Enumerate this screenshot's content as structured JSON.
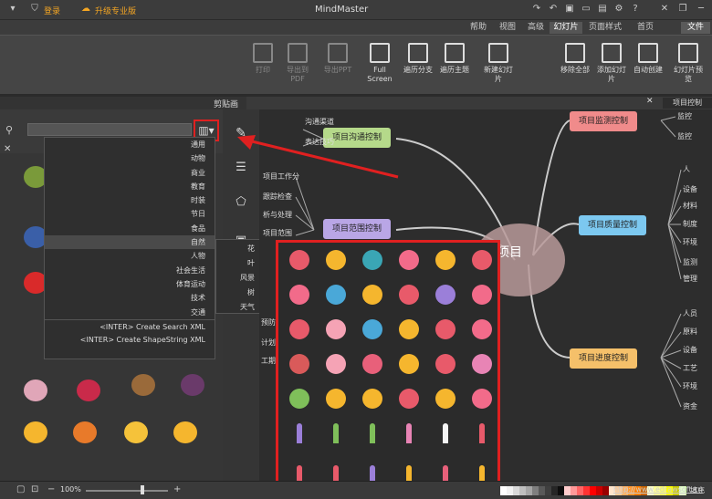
{
  "app": {
    "title": "MindMaster",
    "upgrade": "升级专业版",
    "login": "登录"
  },
  "menu": {
    "file": "文件",
    "tabs": [
      "首页",
      "页面样式",
      "幻灯片",
      "高级",
      "视图",
      "帮助"
    ]
  },
  "ribbon": {
    "buttons": [
      {
        "label": "幻灯片预览",
        "icon": "slides-preview-icon"
      },
      {
        "label": "自动创建",
        "icon": "auto-create-icon"
      },
      {
        "label": "添加幻灯片",
        "icon": "add-slide-icon"
      },
      {
        "label": "移除全部",
        "icon": "remove-all-icon"
      },
      {
        "label": "新建幻灯片",
        "icon": "new-slide-icon"
      },
      {
        "label": "遍历主题",
        "icon": "traverse-topic-icon"
      },
      {
        "label": "遍历分支",
        "icon": "traverse-branch-icon"
      },
      {
        "label": "Full Screen",
        "icon": "fullscreen-icon"
      },
      {
        "label": "导出PPT",
        "icon": "export-ppt-icon"
      },
      {
        "label": "导出到PDF",
        "icon": "export-pdf-icon"
      },
      {
        "label": "打印",
        "icon": "print-icon"
      }
    ]
  },
  "document_tab": {
    "label": "项目控制"
  },
  "clipart_panel": {
    "title": "剪贴画",
    "search_placeholder": "",
    "dropdown_items": [
      "通用",
      "动物",
      "商业",
      "教育",
      "时装",
      "节日",
      "食品",
      "自然",
      "人物",
      "社会生活",
      "体育运动",
      "技术",
      "交通",
      "<INTER> Create Search XML",
      "<INTER> Create ShapeString XML"
    ],
    "highlighted_item": "自然",
    "submenu_items": [
      "花",
      "叶",
      "风景",
      "树",
      "天气"
    ]
  },
  "mindmap": {
    "central": "项目",
    "right_topics": [
      {
        "label": "项目沟通控制",
        "color": "#b5d98a",
        "subs": [
          "沟通渠道",
          "表达技巧"
        ]
      },
      {
        "label": "项目范围控制",
        "color": "#b9a6e6",
        "subs": [
          "项目工作分",
          "跟踪检查",
          "析与处理",
          "项目范围"
        ]
      }
    ],
    "left_topics": [
      {
        "label": "项目监测控制",
        "color": "#f08b8b",
        "subs": [
          "监控",
          "监控"
        ]
      },
      {
        "label": "项目质量控制",
        "color": "#7cc8f0",
        "subs": [
          "人",
          "设备",
          "材料",
          "制度",
          "环境",
          "监测",
          "管理"
        ]
      },
      {
        "label": "项目进度控制",
        "color": "#f5c06a",
        "subs": [
          "人员",
          "原料",
          "设备",
          "工艺",
          "环境",
          "资金"
        ]
      }
    ],
    "mid_labels": [
      "预防",
      "计划",
      "工期"
    ]
  },
  "status": {
    "zoom": "100%",
    "url": "http://www.edrawsoft.cn",
    "fill_label": "填充"
  },
  "palette": [
    "#ffffff",
    "#f2f2f2",
    "#d9d9d9",
    "#bfbfbf",
    "#a6a6a6",
    "#7f7f7f",
    "#595959",
    "#3f3f3f",
    "#262626",
    "#0d0d0d",
    "#ffcccc",
    "#ff9999",
    "#ff6666",
    "#ff3333",
    "#ff0000",
    "#cc0000",
    "#990000",
    "#ffe5cc",
    "#ffcc99",
    "#ffb266",
    "#ff9933",
    "#ff8000",
    "#cc6600",
    "#ffffcc",
    "#ffff99",
    "#ffff66",
    "#ffff00",
    "#cccc00",
    "#e5ffcc",
    "#ccff99",
    "#99ff33",
    "#66cc00",
    "#ccffe5",
    "#99ffcc",
    "#33ff99",
    "#00cc66",
    "#ccffff",
    "#99ffff",
    "#33ffff",
    "#00cccc",
    "#cce5ff",
    "#99ccff",
    "#3399ff",
    "#0066cc",
    "#e5ccff",
    "#cc99ff",
    "#9933ff",
    "#6600cc",
    "#ffccff",
    "#ff99ff",
    "#ff33ff",
    "#cc00cc",
    "#e6194b",
    "#3cb44b",
    "#ffe119",
    "#4363d8",
    "#f58231",
    "#911eb4",
    "#46f0f0",
    "#f032e6",
    "#bcf60c"
  ],
  "flower_colors": [
    "#e85a6a",
    "#f5b62e",
    "#3aa6b5",
    "#f26b8a",
    "#f5b62e",
    "#e85a6a",
    "#f26b8a",
    "#4aa8d8",
    "#f5b62e",
    "#e85a6a",
    "#9b7fd9",
    "#f26b8a",
    "#e85a6a",
    "#f5a3b5",
    "#4aa8d8",
    "#f5b62e",
    "#e85a6a",
    "#f26b8a",
    "#d95a5a",
    "#f5a3b5",
    "#e8607a",
    "#f5b62e",
    "#e85a6a",
    "#e884b5",
    "#7fbf5a",
    "#f5b62e",
    "#f5b62e",
    "#e85a6a",
    "#f5b62e",
    "#f26b8a",
    "#9b7fd9",
    "#7fbf5a",
    "#7fbf5a",
    "#e884b5",
    "#f5f5f5",
    "#e85a6a"
  ],
  "fruit_colors": [
    "#7a9a3a",
    "#3a5fa8",
    "#d92a2a",
    "#e0a6b8",
    "#c92a4a",
    "#9a6a3a",
    "#6a3a6a",
    "#f5b62e",
    "#e87a2a",
    "#f5c23a"
  ]
}
